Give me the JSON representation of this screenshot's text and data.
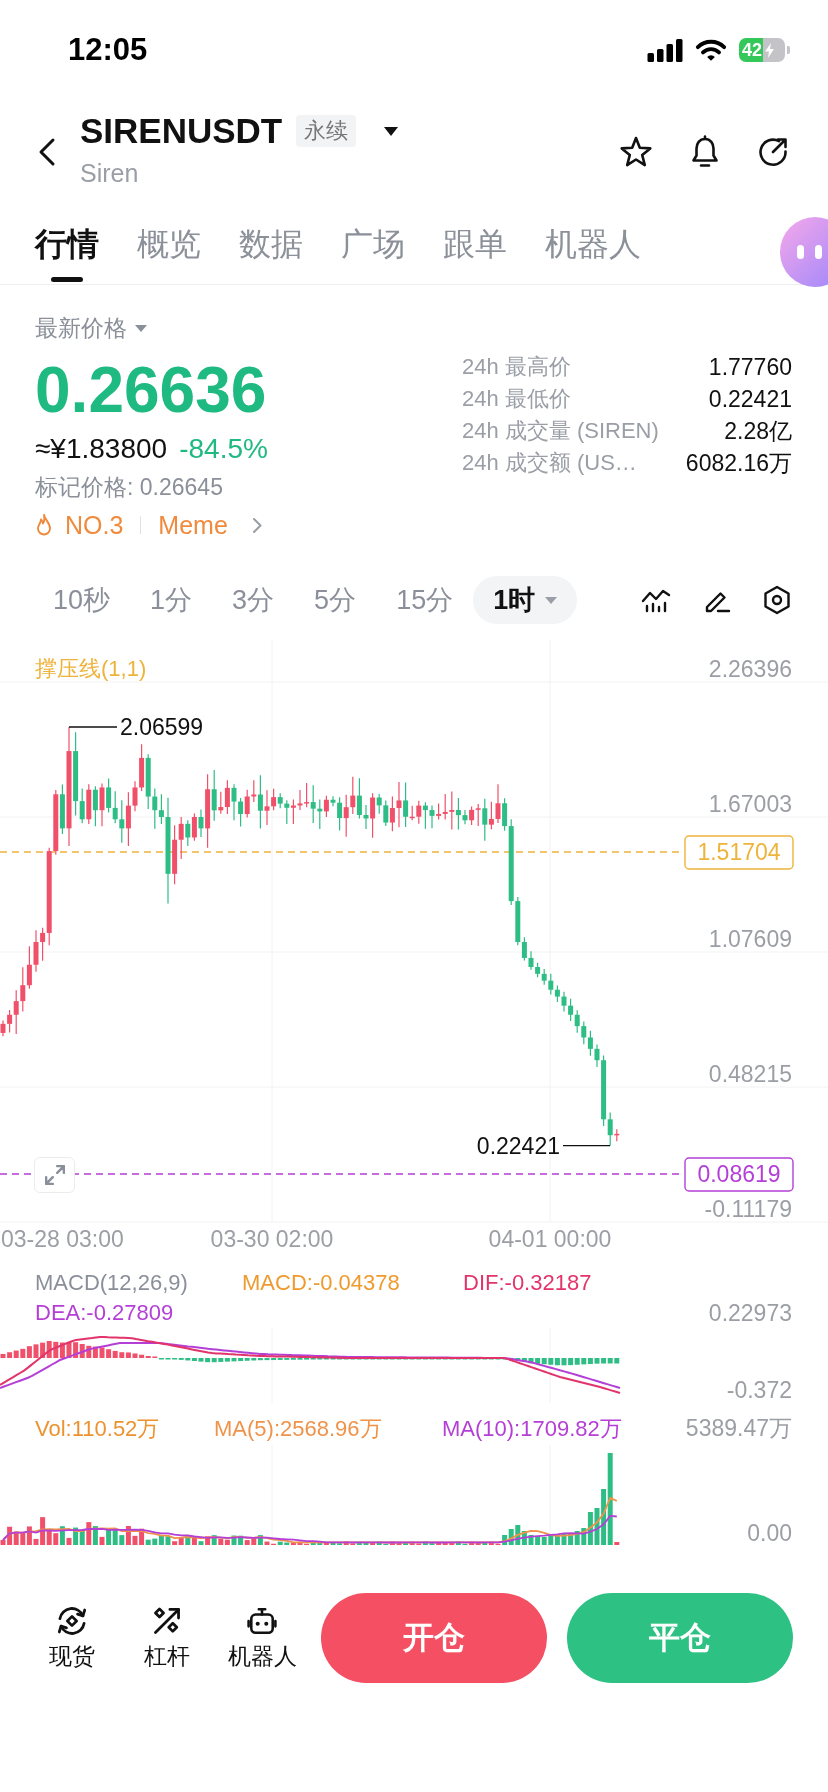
{
  "status_bar": {
    "time": "12:05",
    "battery": "42"
  },
  "header": {
    "symbol": "SIRENUSDT",
    "contract_type": "永续",
    "name": "Siren"
  },
  "tabs": [
    {
      "label": "行情",
      "selected": true
    },
    {
      "label": "概览",
      "selected": false
    },
    {
      "label": "数据",
      "selected": false
    },
    {
      "label": "广场",
      "selected": false
    },
    {
      "label": "跟单",
      "selected": false
    },
    {
      "label": "机器人",
      "selected": false
    }
  ],
  "ticker": {
    "price_type": "最新价格",
    "last_price": "0.26636",
    "cny_price": "≈¥1.83800",
    "change": "-84.5%",
    "mark_price": "标记价格: 0.26645",
    "rank": "NO.3",
    "category": "Meme"
  },
  "stats": [
    {
      "label": "24h 最高价",
      "value": "1.77760"
    },
    {
      "label": "24h 最低价",
      "value": "0.22421"
    },
    {
      "label": "24h 成交量 (SIREN)",
      "value": "2.28亿"
    },
    {
      "label": "24h 成交额 (US…",
      "value": "6082.16万"
    }
  ],
  "intervals": [
    {
      "label": "10秒",
      "selected": false
    },
    {
      "label": "1分",
      "selected": false
    },
    {
      "label": "3分",
      "selected": false
    },
    {
      "label": "5分",
      "selected": false
    },
    {
      "label": "15分",
      "selected": false
    },
    {
      "label": "1时",
      "selected": true
    }
  ],
  "price_chart": {
    "indicator": "撑压线(1,1)",
    "y_ticks": [
      "2.26396",
      "1.67003",
      "1.07609",
      "0.48215",
      "-0.11179"
    ],
    "resistance_label": "1.51704",
    "support_label": "0.08619",
    "high_label": "2.06599",
    "low_label": "0.22421",
    "x_ticks": [
      "03-28 03:00",
      "03-30 02:00",
      "04-01 00:00"
    ]
  },
  "macd": {
    "title": "MACD(12,26,9)",
    "macd": "MACD:-0.04378",
    "dif": "DIF:-0.32187",
    "dea": "DEA:-0.27809",
    "y_ticks": [
      "0.22973",
      "-0.372"
    ]
  },
  "volume": {
    "vol": "Vol:110.52万",
    "ma5": "MA(5):2568.96万",
    "ma10": "MA(10):1709.82万",
    "y_ticks": [
      "5389.47万",
      "0.00"
    ]
  },
  "bottom_nav": [
    {
      "label": "现货",
      "kind": "spot"
    },
    {
      "label": "杠杆",
      "kind": "margin"
    },
    {
      "label": "机器人",
      "kind": "bot"
    }
  ],
  "actions": [
    {
      "label": "开仓",
      "kind": "open"
    },
    {
      "label": "平仓",
      "kind": "close"
    }
  ]
}
